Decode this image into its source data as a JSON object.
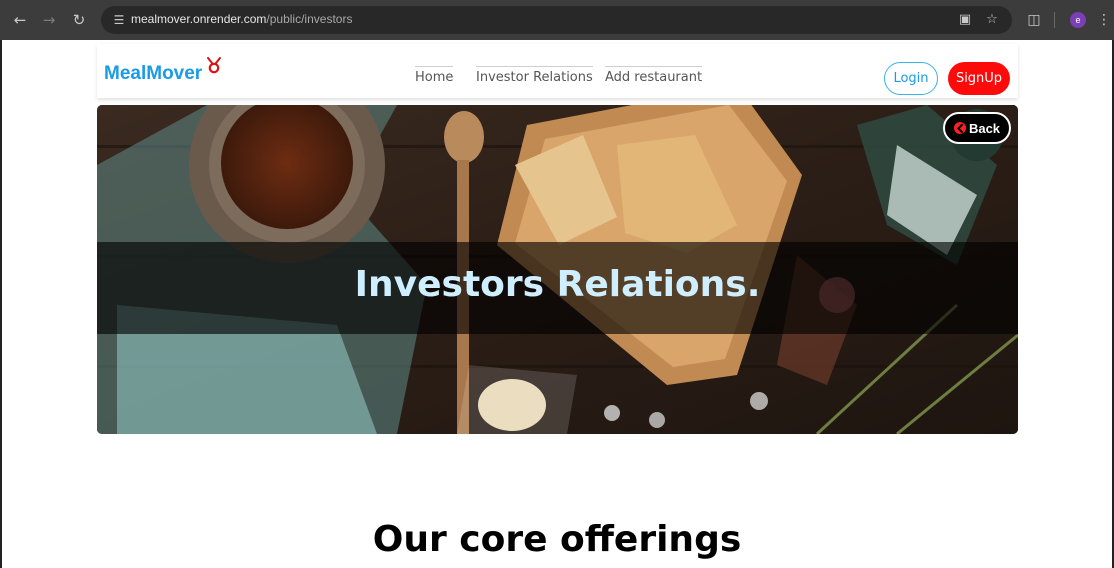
{
  "browser": {
    "url_host": "mealmover.onrender.com",
    "url_path": "/public/investors",
    "profile_initial": "e"
  },
  "navbar": {
    "brand": "MealMover",
    "links": [
      "Home",
      "Investor Relations",
      "Add restaurant"
    ],
    "login_label": "Login",
    "signup_label": "SignUp"
  },
  "hero": {
    "title": "Investors Relations.",
    "back_label": "Back"
  },
  "section": {
    "title": "Our core offerings"
  },
  "colors": {
    "brand": "#1a9be6",
    "signup_bg": "#ff0a0a",
    "hero_title": "#cfeeff"
  }
}
